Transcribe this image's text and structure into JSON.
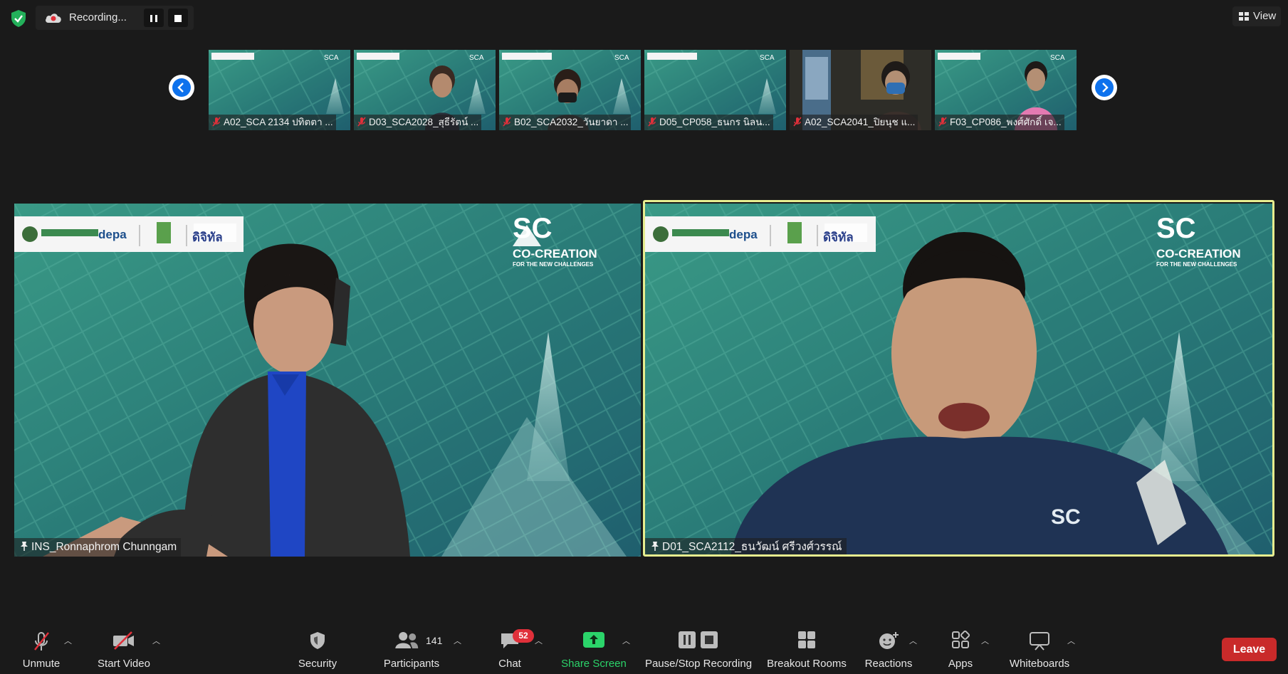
{
  "recording": {
    "status_label": "Recording..."
  },
  "view_button": {
    "label": "View"
  },
  "gallery_strip": {
    "thumbnails": [
      {
        "name": "A02_SCA 2134 ปทิตตา ..."
      },
      {
        "name": "D03_SCA2028_สุธีรัตน์ ..."
      },
      {
        "name": "B02_SCA2032_วันยาดา ..."
      },
      {
        "name": "D05_CP058_ธนกร นิลน..."
      },
      {
        "name": "A02_SCA2041_ปิยนุช แ..."
      },
      {
        "name": "F03_CP086_พงศ์ศักดิ์ เจ..."
      }
    ]
  },
  "main_tiles": {
    "left": {
      "participant_name": "INS_Ronnaphrom Chunngam",
      "banner": {
        "sca_title": "SC",
        "co_creation": "CO-CREATION",
        "subtitle": "FOR THE NEW CHALLENGES",
        "depa": "depa",
        "digital": "ดิจิทัล"
      }
    },
    "right": {
      "participant_name": "D01_SCA2112_ธนวัฒน์ ศรีวงศ์วรรณ์",
      "active_speaker": true,
      "banner": {
        "sca_title": "SC",
        "co_creation": "CO-CREATION",
        "subtitle": "FOR THE NEW CHALLENGES",
        "depa": "depa",
        "digital": "ดิจิทัล"
      }
    }
  },
  "toolbar": {
    "unmute_label": "Unmute",
    "start_video_label": "Start Video",
    "security_label": "Security",
    "participants_label": "Participants",
    "participants_count": "141",
    "chat_label": "Chat",
    "chat_badge": "52",
    "share_screen_label": "Share Screen",
    "recording_label": "Pause/Stop Recording",
    "breakout_label": "Breakout Rooms",
    "reactions_label": "Reactions",
    "apps_label": "Apps",
    "whiteboards_label": "Whiteboards",
    "leave_label": "Leave"
  },
  "colors": {
    "background": "#1a1a1a",
    "active_speaker_border": "#e7ee8f",
    "share_screen_green": "#2bd46a",
    "leave_red": "#c92a2a",
    "badge_red": "#e0303a",
    "muted_red": "#e0303a",
    "video_teal": "#2b7b74"
  }
}
